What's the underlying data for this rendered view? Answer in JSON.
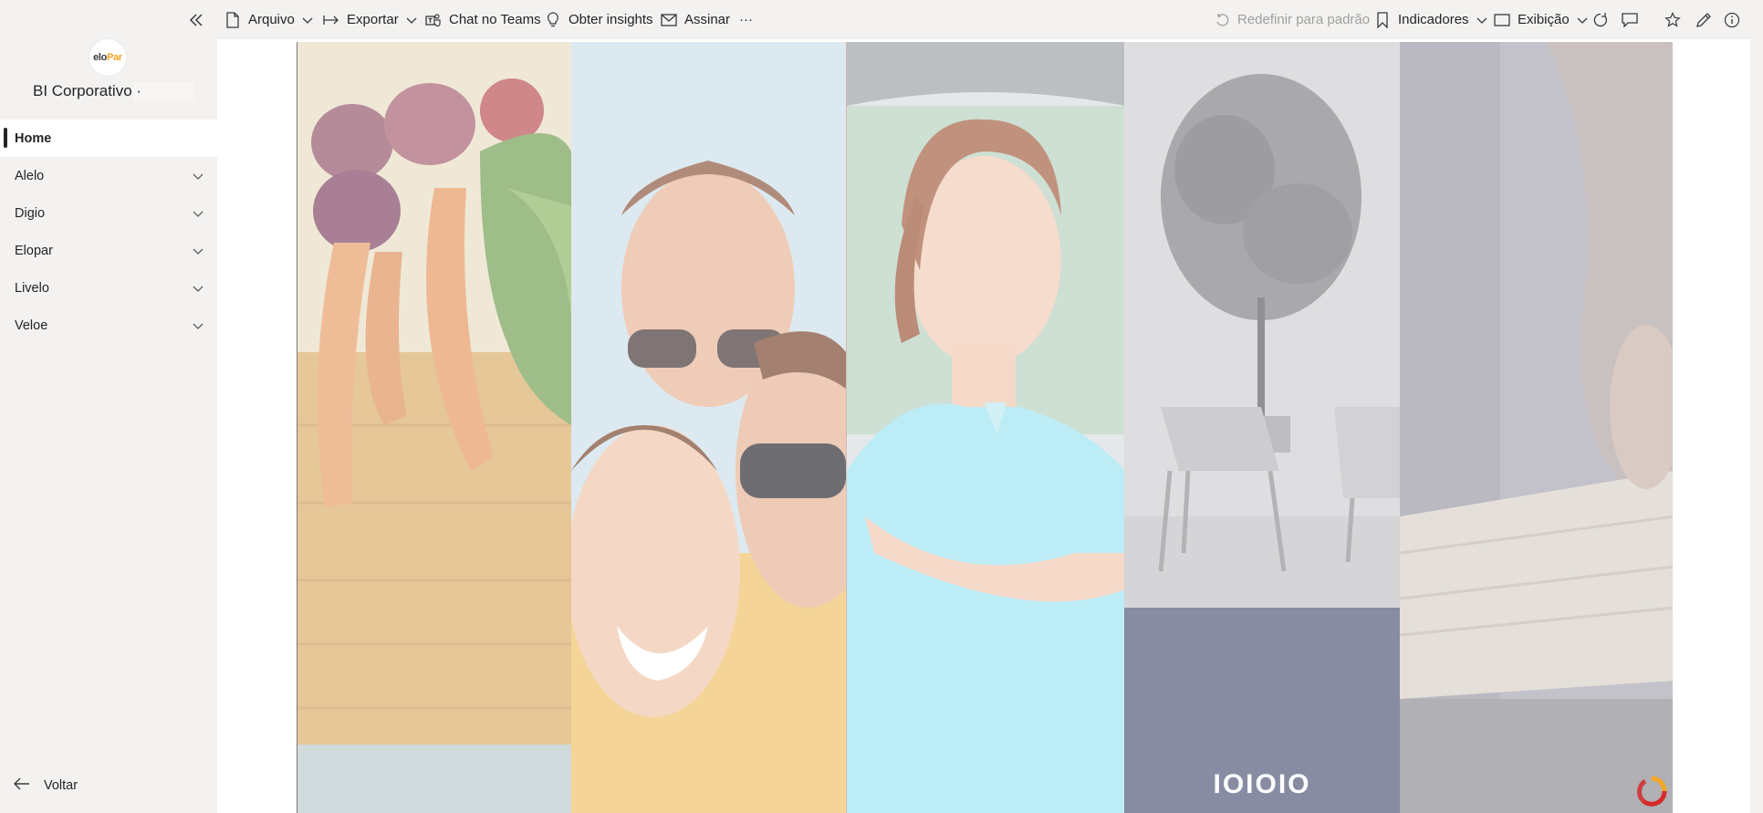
{
  "toolbar": {
    "arquivo": "Arquivo",
    "exportar": "Exportar",
    "chat_teams": "Chat no Teams",
    "insights": "Obter insights",
    "assinar": "Assinar",
    "more": "···",
    "reset": "Redefinir para padrão",
    "indicadores": "Indicadores",
    "exibicao": "Exibição"
  },
  "sidebar": {
    "logo_text_a": "elo",
    "logo_text_b": "Par",
    "workspace_title": "BI Corporativo ·",
    "items": [
      {
        "label": "Home",
        "active": true,
        "expandable": false
      },
      {
        "label": "Alelo",
        "active": false,
        "expandable": true
      },
      {
        "label": "Digio",
        "active": false,
        "expandable": true
      },
      {
        "label": "Elopar",
        "active": false,
        "expandable": true
      },
      {
        "label": "Livelo",
        "active": false,
        "expandable": true
      },
      {
        "label": "Veloe",
        "active": false,
        "expandable": true
      }
    ],
    "back_label": "Voltar"
  },
  "report": {
    "brand_word": "IOIOIO"
  },
  "colors": {
    "brand_block": "#878ca3",
    "corner_logo_orange": "#f5a623",
    "corner_logo_red": "#d62b2b"
  }
}
